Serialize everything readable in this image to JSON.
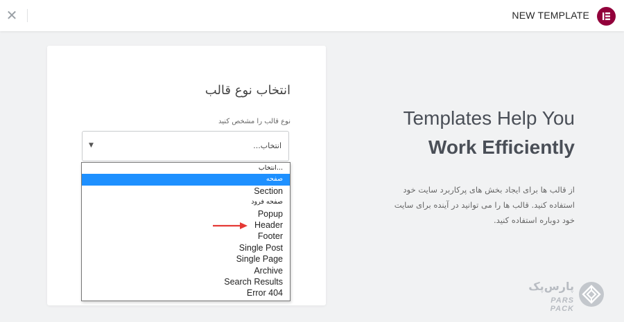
{
  "header": {
    "title": "NEW TEMPLATE",
    "close_icon": "close-icon",
    "logo_icon": "elementor-logo-icon",
    "logo_color": "#92003b"
  },
  "form": {
    "title": "انتخاب نوع قالب",
    "field_label": "نوع قالب را مشخص کنید",
    "select_value": "انتخاب...",
    "options": [
      "انتخاب...",
      "صفحه",
      "Section",
      "صفحه فرود",
      "Popup",
      "Header",
      "Footer",
      "Single Post",
      "Single Page",
      "Archive",
      "Search Results",
      "Error 404"
    ],
    "highlighted_option": "صفحه",
    "highlight_color": "#1e90ff",
    "annotation": "red-arrow-pointing-to-header",
    "annotation_color": "#e53935"
  },
  "hero": {
    "line1": "Templates Help You",
    "line2": "Work Efficiently",
    "description": "از قالب ها برای ایجاد بخش های پرکاربرد سایت خود استفاده کنید. قالب ها را می توانید در آینده برای سایت خود دوباره استفاده کنید."
  },
  "watermark": {
    "name_fa": "پارس‌پک",
    "name_en": "PARS PACK",
    "icon": "parspack-logo-icon"
  }
}
